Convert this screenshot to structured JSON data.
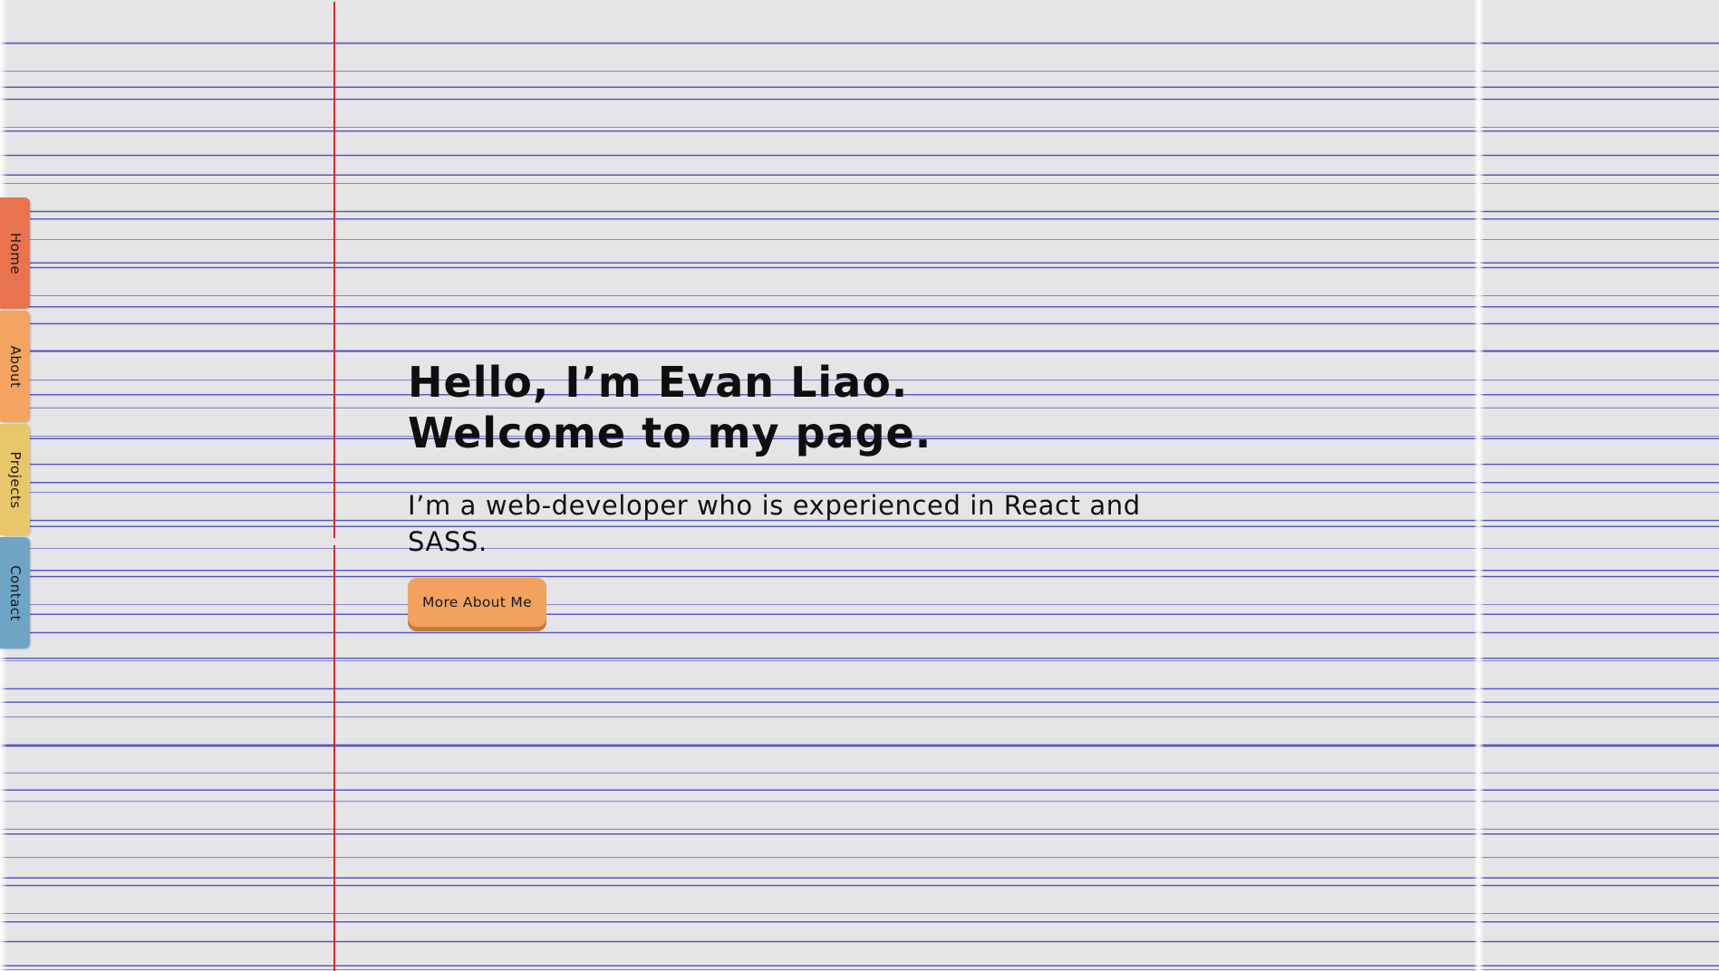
{
  "nav": {
    "tabs": [
      {
        "label": "Home",
        "color": "#e9734f"
      },
      {
        "label": "About",
        "color": "#f3a461"
      },
      {
        "label": "Projects",
        "color": "#e8c66a"
      },
      {
        "label": "Contact",
        "color": "#6fa4c6"
      }
    ]
  },
  "hero": {
    "heading_line1": "Hello, I’m Evan Liao.",
    "heading_line2": "Welcome to my page.",
    "subtitle": "I’m a web-developer who is experienced in React and SASS.",
    "button_label": "More About Me"
  },
  "colors": {
    "paper": "#e5e5e7",
    "rule_line": "#5252bd",
    "margin_line": "#d92a2a",
    "button": "#f2a15e"
  }
}
